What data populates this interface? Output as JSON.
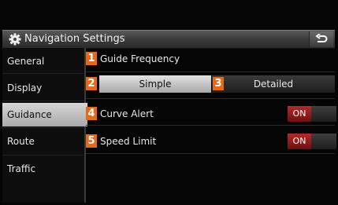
{
  "header": {
    "title": "Navigation Settings",
    "gear_icon": "gear-icon",
    "back_icon": "back-arrow-icon"
  },
  "sidebar": {
    "items": [
      {
        "label": "General"
      },
      {
        "label": "Display"
      },
      {
        "label": "Guidance",
        "active": true
      },
      {
        "label": "Route"
      },
      {
        "label": "Traffic"
      }
    ]
  },
  "settings": {
    "guide_frequency": {
      "number": "1",
      "label": "Guide Frequency",
      "simple_number": "2",
      "simple_label": "Simple",
      "detailed_number": "3",
      "detailed_label": "Detailed",
      "selected": "Simple"
    },
    "curve_alert": {
      "number": "4",
      "label": "Curve Alert",
      "state": "ON"
    },
    "speed_limit": {
      "number": "5",
      "label": "Speed Limit",
      "state": "ON"
    }
  },
  "colors": {
    "accent": "#e36a1c",
    "toggle_on": "#b52a2a",
    "selected_tab": "#c8c8c8"
  }
}
